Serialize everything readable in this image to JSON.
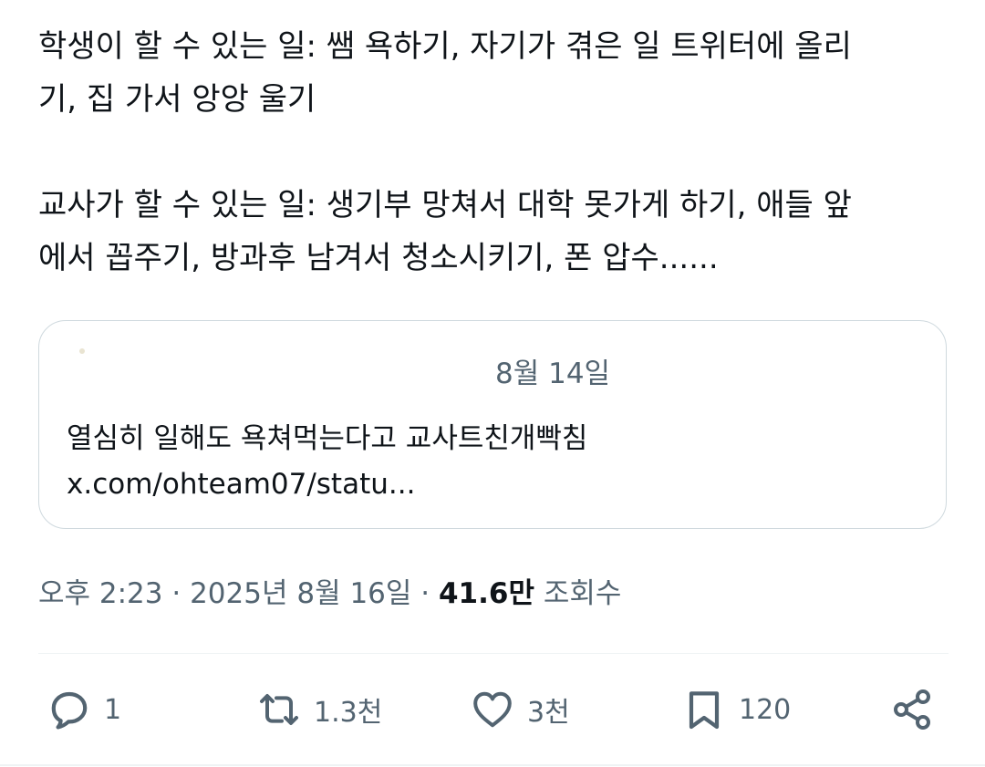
{
  "tweet": {
    "paragraph1_line1": "학생이 할 수 있는 일: 쌤 욕하기, 자기가 겪은 일 트위터에 올리",
    "paragraph1_line2": "기, 집 가서 앙앙 울기",
    "paragraph2_line1": "교사가 할 수 있는 일: 생기부 망쳐서 대학 못가게 하기, 애들 앞",
    "paragraph2_line2": "에서 꼽주기, 방과후 남겨서 청소시키기, 폰 압수......"
  },
  "quote": {
    "date": "8월 14일",
    "text": "열심히 일해도 욕쳐먹는다고 교사트친개빡침",
    "link": "x.com/ohteam07/statu..."
  },
  "meta": {
    "time": "오후 2:23",
    "separator1": " · ",
    "date": "2025년 8월 16일",
    "separator2": " · ",
    "views_count": "41.6만",
    "views_label": " 조회수"
  },
  "actions": {
    "reply": {
      "icon": "reply-icon",
      "count": "1"
    },
    "retweet": {
      "icon": "retweet-icon",
      "count": "1.3천"
    },
    "like": {
      "icon": "heart-icon",
      "count": "3천"
    },
    "bookmark": {
      "icon": "bookmark-icon",
      "count": "120"
    },
    "share": {
      "icon": "share-icon"
    }
  },
  "colors": {
    "text_primary": "#0f1419",
    "text_secondary": "#536471",
    "border": "#cfd9de",
    "divider": "#eff3f4"
  }
}
